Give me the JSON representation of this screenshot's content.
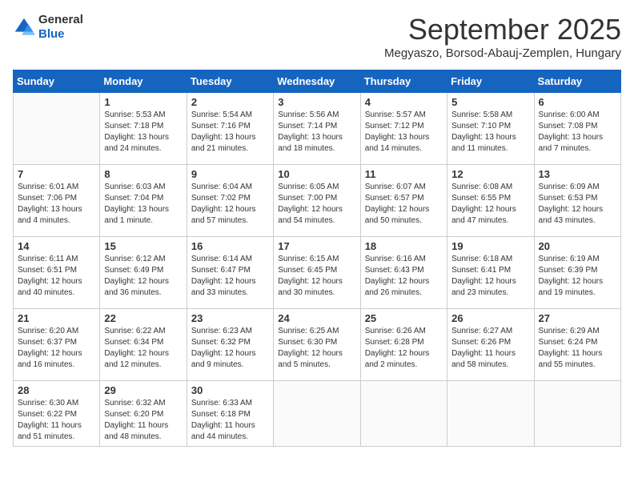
{
  "header": {
    "logo": {
      "general": "General",
      "blue": "Blue"
    },
    "month": "September 2025",
    "location": "Megyaszo, Borsod-Abauj-Zemplen, Hungary"
  },
  "weekdays": [
    "Sunday",
    "Monday",
    "Tuesday",
    "Wednesday",
    "Thursday",
    "Friday",
    "Saturday"
  ],
  "weeks": [
    [
      {
        "day": "",
        "sunrise": "",
        "sunset": "",
        "daylight": ""
      },
      {
        "day": "1",
        "sunrise": "Sunrise: 5:53 AM",
        "sunset": "Sunset: 7:18 PM",
        "daylight": "Daylight: 13 hours and 24 minutes."
      },
      {
        "day": "2",
        "sunrise": "Sunrise: 5:54 AM",
        "sunset": "Sunset: 7:16 PM",
        "daylight": "Daylight: 13 hours and 21 minutes."
      },
      {
        "day": "3",
        "sunrise": "Sunrise: 5:56 AM",
        "sunset": "Sunset: 7:14 PM",
        "daylight": "Daylight: 13 hours and 18 minutes."
      },
      {
        "day": "4",
        "sunrise": "Sunrise: 5:57 AM",
        "sunset": "Sunset: 7:12 PM",
        "daylight": "Daylight: 13 hours and 14 minutes."
      },
      {
        "day": "5",
        "sunrise": "Sunrise: 5:58 AM",
        "sunset": "Sunset: 7:10 PM",
        "daylight": "Daylight: 13 hours and 11 minutes."
      },
      {
        "day": "6",
        "sunrise": "Sunrise: 6:00 AM",
        "sunset": "Sunset: 7:08 PM",
        "daylight": "Daylight: 13 hours and 7 minutes."
      }
    ],
    [
      {
        "day": "7",
        "sunrise": "Sunrise: 6:01 AM",
        "sunset": "Sunset: 7:06 PM",
        "daylight": "Daylight: 13 hours and 4 minutes."
      },
      {
        "day": "8",
        "sunrise": "Sunrise: 6:03 AM",
        "sunset": "Sunset: 7:04 PM",
        "daylight": "Daylight: 13 hours and 1 minute."
      },
      {
        "day": "9",
        "sunrise": "Sunrise: 6:04 AM",
        "sunset": "Sunset: 7:02 PM",
        "daylight": "Daylight: 12 hours and 57 minutes."
      },
      {
        "day": "10",
        "sunrise": "Sunrise: 6:05 AM",
        "sunset": "Sunset: 7:00 PM",
        "daylight": "Daylight: 12 hours and 54 minutes."
      },
      {
        "day": "11",
        "sunrise": "Sunrise: 6:07 AM",
        "sunset": "Sunset: 6:57 PM",
        "daylight": "Daylight: 12 hours and 50 minutes."
      },
      {
        "day": "12",
        "sunrise": "Sunrise: 6:08 AM",
        "sunset": "Sunset: 6:55 PM",
        "daylight": "Daylight: 12 hours and 47 minutes."
      },
      {
        "day": "13",
        "sunrise": "Sunrise: 6:09 AM",
        "sunset": "Sunset: 6:53 PM",
        "daylight": "Daylight: 12 hours and 43 minutes."
      }
    ],
    [
      {
        "day": "14",
        "sunrise": "Sunrise: 6:11 AM",
        "sunset": "Sunset: 6:51 PM",
        "daylight": "Daylight: 12 hours and 40 minutes."
      },
      {
        "day": "15",
        "sunrise": "Sunrise: 6:12 AM",
        "sunset": "Sunset: 6:49 PM",
        "daylight": "Daylight: 12 hours and 36 minutes."
      },
      {
        "day": "16",
        "sunrise": "Sunrise: 6:14 AM",
        "sunset": "Sunset: 6:47 PM",
        "daylight": "Daylight: 12 hours and 33 minutes."
      },
      {
        "day": "17",
        "sunrise": "Sunrise: 6:15 AM",
        "sunset": "Sunset: 6:45 PM",
        "daylight": "Daylight: 12 hours and 30 minutes."
      },
      {
        "day": "18",
        "sunrise": "Sunrise: 6:16 AM",
        "sunset": "Sunset: 6:43 PM",
        "daylight": "Daylight: 12 hours and 26 minutes."
      },
      {
        "day": "19",
        "sunrise": "Sunrise: 6:18 AM",
        "sunset": "Sunset: 6:41 PM",
        "daylight": "Daylight: 12 hours and 23 minutes."
      },
      {
        "day": "20",
        "sunrise": "Sunrise: 6:19 AM",
        "sunset": "Sunset: 6:39 PM",
        "daylight": "Daylight: 12 hours and 19 minutes."
      }
    ],
    [
      {
        "day": "21",
        "sunrise": "Sunrise: 6:20 AM",
        "sunset": "Sunset: 6:37 PM",
        "daylight": "Daylight: 12 hours and 16 minutes."
      },
      {
        "day": "22",
        "sunrise": "Sunrise: 6:22 AM",
        "sunset": "Sunset: 6:34 PM",
        "daylight": "Daylight: 12 hours and 12 minutes."
      },
      {
        "day": "23",
        "sunrise": "Sunrise: 6:23 AM",
        "sunset": "Sunset: 6:32 PM",
        "daylight": "Daylight: 12 hours and 9 minutes."
      },
      {
        "day": "24",
        "sunrise": "Sunrise: 6:25 AM",
        "sunset": "Sunset: 6:30 PM",
        "daylight": "Daylight: 12 hours and 5 minutes."
      },
      {
        "day": "25",
        "sunrise": "Sunrise: 6:26 AM",
        "sunset": "Sunset: 6:28 PM",
        "daylight": "Daylight: 12 hours and 2 minutes."
      },
      {
        "day": "26",
        "sunrise": "Sunrise: 6:27 AM",
        "sunset": "Sunset: 6:26 PM",
        "daylight": "Daylight: 11 hours and 58 minutes."
      },
      {
        "day": "27",
        "sunrise": "Sunrise: 6:29 AM",
        "sunset": "Sunset: 6:24 PM",
        "daylight": "Daylight: 11 hours and 55 minutes."
      }
    ],
    [
      {
        "day": "28",
        "sunrise": "Sunrise: 6:30 AM",
        "sunset": "Sunset: 6:22 PM",
        "daylight": "Daylight: 11 hours and 51 minutes."
      },
      {
        "day": "29",
        "sunrise": "Sunrise: 6:32 AM",
        "sunset": "Sunset: 6:20 PM",
        "daylight": "Daylight: 11 hours and 48 minutes."
      },
      {
        "day": "30",
        "sunrise": "Sunrise: 6:33 AM",
        "sunset": "Sunset: 6:18 PM",
        "daylight": "Daylight: 11 hours and 44 minutes."
      },
      {
        "day": "",
        "sunrise": "",
        "sunset": "",
        "daylight": ""
      },
      {
        "day": "",
        "sunrise": "",
        "sunset": "",
        "daylight": ""
      },
      {
        "day": "",
        "sunrise": "",
        "sunset": "",
        "daylight": ""
      },
      {
        "day": "",
        "sunrise": "",
        "sunset": "",
        "daylight": ""
      }
    ]
  ]
}
